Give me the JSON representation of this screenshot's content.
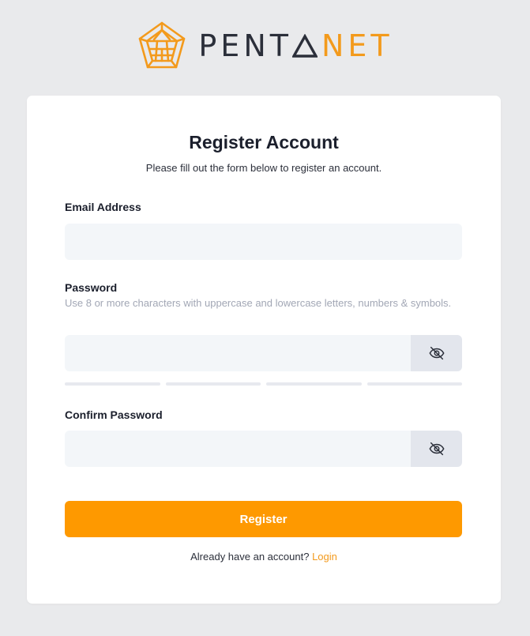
{
  "brand": {
    "logo_icon": "pentagon-web-logo-icon",
    "name_dark": "PENT",
    "name_delta": "A",
    "name_orange": "NET",
    "colors": {
      "accent": "#f39a1c",
      "button": "#fe9900",
      "dark": "#2b2f3a",
      "page_bg": "#e9eaec",
      "input_bg": "#f3f6f9",
      "toggle_bg": "#e3e6ed"
    }
  },
  "form": {
    "title": "Register Account",
    "subtitle": "Please fill out the form below to register an account.",
    "email": {
      "label": "Email Address",
      "value": "",
      "placeholder": ""
    },
    "password": {
      "label": "Password",
      "hint": "Use 8 or more characters with uppercase and lowercase letters, numbers & symbols.",
      "value": "",
      "placeholder": "",
      "toggle_icon": "eye-slash-icon",
      "strength_segments_filled": 0,
      "strength_segments_total": 4
    },
    "confirm_password": {
      "label": "Confirm Password",
      "value": "",
      "placeholder": "",
      "toggle_icon": "eye-slash-icon"
    },
    "submit_label": "Register",
    "footer_text": "Already have an account?",
    "footer_link": "Login"
  }
}
